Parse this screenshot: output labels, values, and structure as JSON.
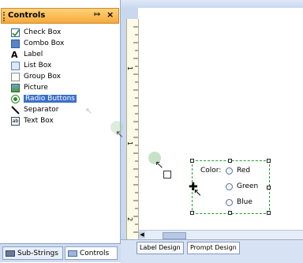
{
  "panel": {
    "title": "Controls",
    "pin_glyph": "→",
    "close_glyph": "×",
    "items": [
      {
        "label": "Check Box",
        "icon": "checkbox-icon"
      },
      {
        "label": "Combo Box",
        "icon": "combobox-icon"
      },
      {
        "label": "Label",
        "icon": "label-icon"
      },
      {
        "label": "List Box",
        "icon": "listbox-icon"
      },
      {
        "label": "Group Box",
        "icon": "groupbox-icon"
      },
      {
        "label": "Picture",
        "icon": "picture-icon"
      },
      {
        "label": "Radio Buttons",
        "icon": "radio-icon",
        "selected": true
      },
      {
        "label": "Separator",
        "icon": "separator-icon"
      },
      {
        "label": "Text Box",
        "icon": "textbox-icon"
      }
    ]
  },
  "bottom_tabs": [
    {
      "label": "Sub-Strings",
      "active": false
    },
    {
      "label": "Controls",
      "active": true
    }
  ],
  "design_tabs": [
    {
      "label": "Label Design",
      "active": false
    },
    {
      "label": "Prompt Design",
      "active": true
    }
  ],
  "ruler_marks": [
    "1",
    "1",
    "2"
  ],
  "form": {
    "color_label": "Color:",
    "options": [
      "Red",
      "Green",
      "Blue"
    ]
  },
  "colors": {
    "header": "#f6a93b",
    "selection": "#3b6fc7",
    "group_border": "#22a02a"
  }
}
